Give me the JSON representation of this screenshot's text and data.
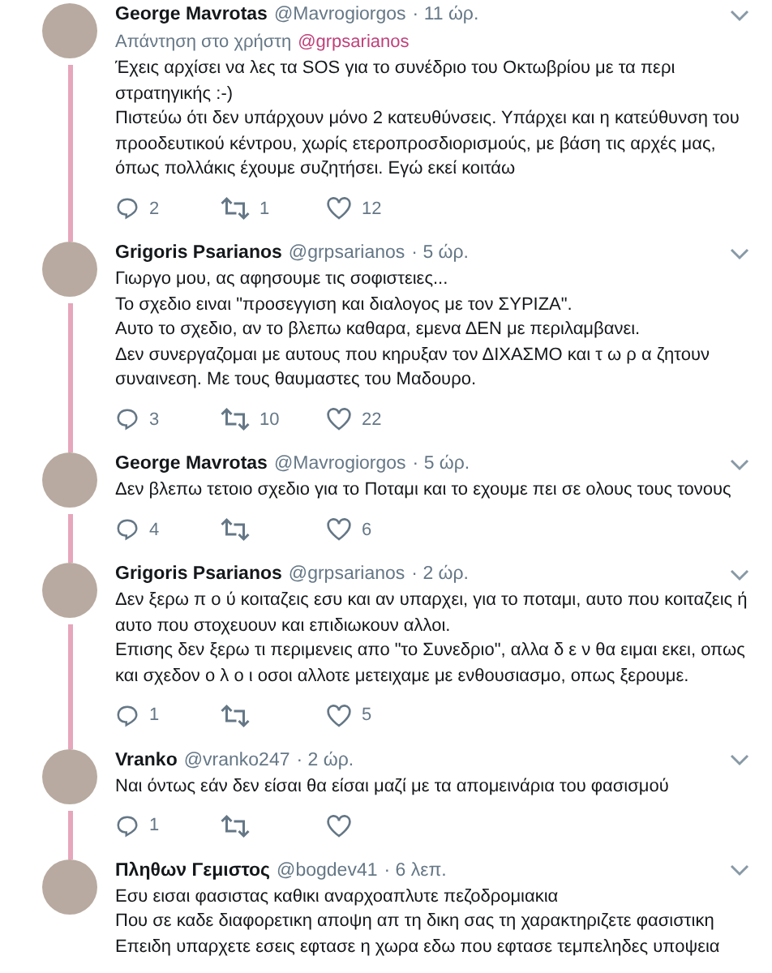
{
  "tweets": [
    {
      "name": "George Mavrotas",
      "handle": "@Mavrogiorgos",
      "time": "· 11 ώρ.",
      "reply_prefix": "Απάντηση στο χρήστη",
      "reply_to": "@grpsarianos",
      "paragraphs": [
        "Έχεις αρχίσει να λες τα SOS για το συνέδριο του Οκτωβρίου με τα περι στρατηγικής :-)",
        "Πιστεύω ότι δεν υπάρχουν μόνο 2 κατευθύνσεις. Υπάρχει και η κατεύθυνση του προοδευτικού κέντρου, χωρίς ετεροπροσδιορισμούς, με βάση τις αρχές μας, όπως πολλάκις έχουμε συζητήσει. Εγώ εκεί κοιτάω"
      ],
      "replies": "2",
      "retweets": "1",
      "likes": "12"
    },
    {
      "name": "Grigoris Psarianos",
      "handle": "@grpsarianos",
      "time": "· 5 ώρ.",
      "paragraphs": [
        "Γιωργο μου,  ας αφησουμε τις σοφιστειες...",
        "Το σχεδιο ειναι \"προσεγγιση και διαλογος με τον ΣΥΡΙΖΑ\".",
        "Αυτο το σχεδιο, αν το βλεπω καθαρα, εμενα ΔΕΝ με περιλαμβανει.",
        "Δεν συνεργαζομαι με αυτους που κηρυξαν τον ΔΙΧΑΣΜΟ και τ ω ρ α ζητουν συναινεση. Με τους θαυμαστες του Μαδουρο."
      ],
      "replies": "3",
      "retweets": "10",
      "likes": "22"
    },
    {
      "name": "George Mavrotas",
      "handle": "@Mavrogiorgos",
      "time": "· 5 ώρ.",
      "paragraphs": [
        "Δεν βλεπω τετοιο σχεδιο για το Ποταμι και το εχουμε πει σε ολους τους τονους"
      ],
      "replies": "4",
      "likes": "6"
    },
    {
      "name": "Grigoris Psarianos",
      "handle": "@grpsarianos",
      "time": "· 2 ώρ.",
      "paragraphs": [
        "Δεν ξερω π ο ύ κοιταζεις εσυ και αν υπαρχει, για το ποταμι, αυτο που κοιταζεις ή αυτο που στοχευουν και επιδιωκουν αλλοι.",
        "Επισης δεν ξερω τι περιμενεις απο \"το Συνεδριο\", αλλα  δ ε ν  θα ειμαι εκει, οπως και σχεδον ο λ ο ι οσοι αλλοτε μετειχαμε με ενθουσιασμο, οπως ξερουμε."
      ],
      "replies": "1",
      "likes": "5"
    },
    {
      "name": "Vranko",
      "handle": "@vranko247",
      "time": "· 2 ώρ.",
      "paragraphs": [
        "Ναι όντως εάν δεν είσαι θα είσαι μαζί με τα απομεινάρια του φασισμού"
      ],
      "replies": "1"
    },
    {
      "name": "Πληθων Γεμιστος",
      "handle": "@bogdev41",
      "time": "· 6 λεπ.",
      "paragraphs": [
        "Εσυ εισαι φασιστας καθικι αναρχοαπλυτε πεζοδρομιακια",
        "Που σε καδε διαφορετικη αποψη απ τη δικη σας τη χαρακτηριζετε φασιστικη",
        "Επειδη υπαρχετε εσεις εφτασε η χωρα εδω που εφτασε τεμπεληδες υποψεια"
      ]
    }
  ]
}
